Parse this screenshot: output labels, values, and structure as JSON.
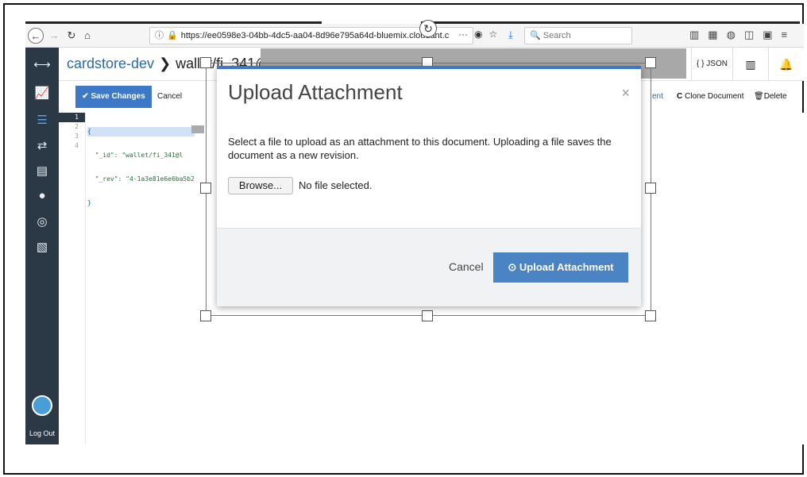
{
  "browser": {
    "url": "https://ee0598e3-04bb-4dc5-aa04-8d96e795a64d-bluemix.cloudant.c",
    "search_placeholder": "Search",
    "url_more": "···"
  },
  "app": {
    "db_name": "cardstore-dev",
    "doc_name": "wallet/fi_341@"
  },
  "header": {
    "json_label": "{ } JSON"
  },
  "toolbar": {
    "save_label": "Save Changes",
    "cancel_label": "Cancel",
    "upload_partial_label": "ent",
    "clone_label": "Clone Document",
    "delete_label": "Delete",
    "attachment_tooltip": "ment"
  },
  "editor": {
    "lines": [
      "1",
      "2",
      "3",
      "4"
    ],
    "code": [
      "{",
      "  \"_id\": \"wallet/fi_341@l",
      "  \"_rev\": \"4-1a3e81e6e6ba5b2",
      "}"
    ]
  },
  "sidebar": {
    "logout_label": "Log Out"
  },
  "modal": {
    "title": "Upload Attachment",
    "close": "×",
    "description": "Select a file to upload as an attachment to this document. Uploading a file saves the document as a new revision.",
    "browse_label": "Browse...",
    "no_file_text": "No file selected.",
    "cancel_label": "Cancel",
    "upload_label": "Upload Attachment"
  },
  "colors": {
    "accent": "#3d79c7",
    "sidebar": "#2b3947"
  }
}
